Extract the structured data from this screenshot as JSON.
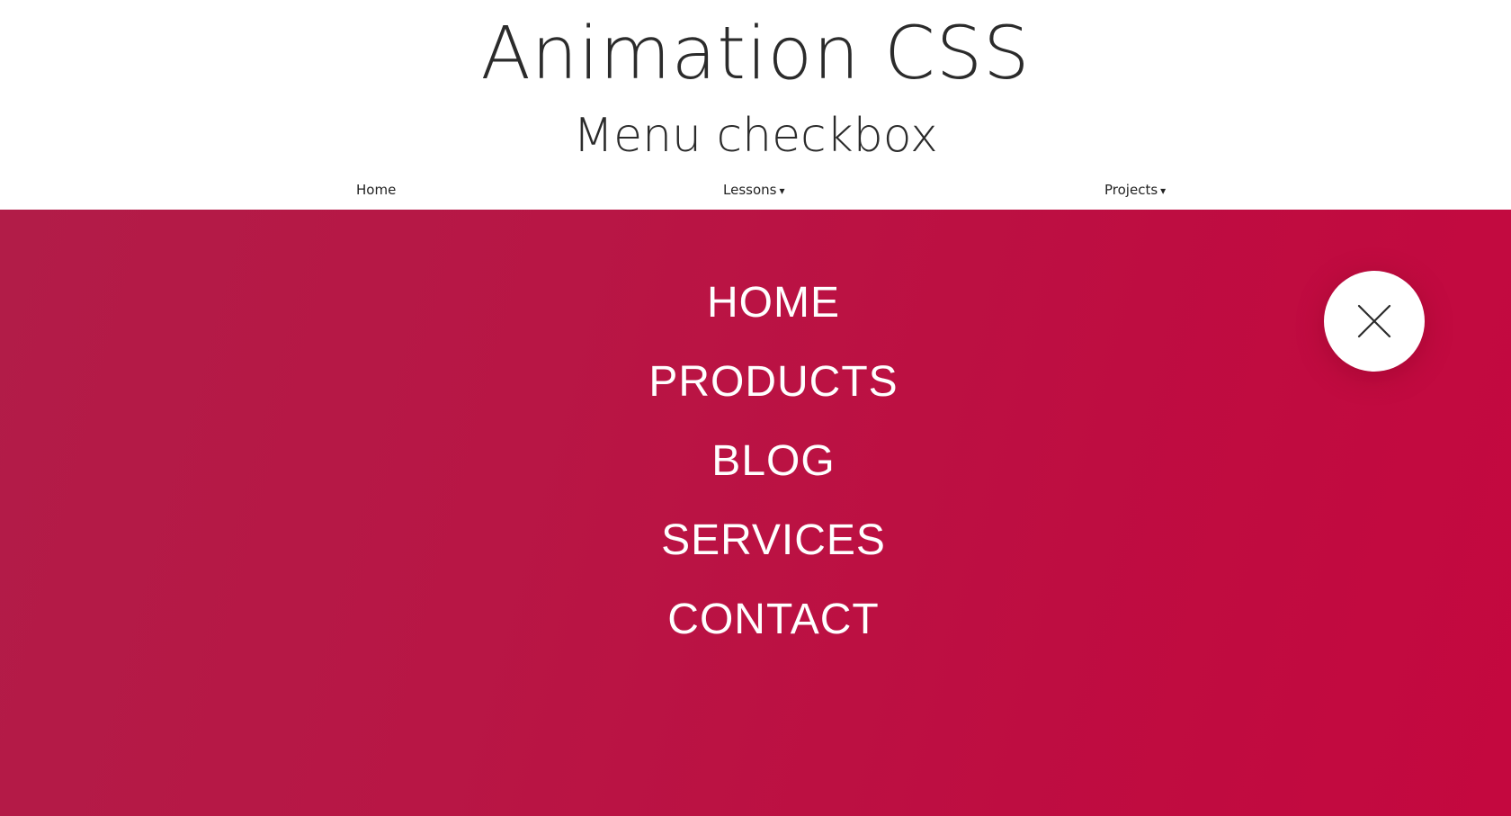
{
  "header": {
    "title": "Animation CSS",
    "subtitle": "Menu checkbox"
  },
  "top_nav": {
    "items": [
      {
        "label": "Home"
      },
      {
        "label": "Lessons",
        "caret": "▾"
      },
      {
        "label": "Projects",
        "caret": "▾"
      }
    ]
  },
  "overlay_menu": {
    "items": [
      {
        "label": "HOME"
      },
      {
        "label": "PRODUCTS"
      },
      {
        "label": "BLOG"
      },
      {
        "label": "SERVICES"
      },
      {
        "label": "CONTACT"
      }
    ],
    "close_icon": "close-icon",
    "background_colors": [
      "#b21c48",
      "#c4083f"
    ],
    "text_color": "#ffffff"
  }
}
